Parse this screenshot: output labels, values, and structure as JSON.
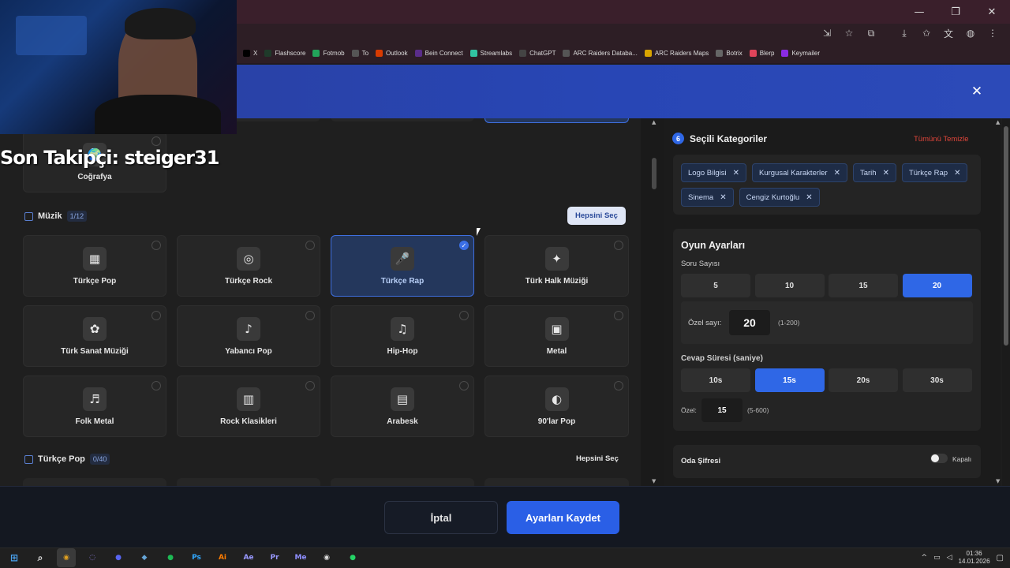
{
  "browser": {
    "bookmarks": [
      {
        "label": "X",
        "icon": "x-icon",
        "color": "#000000"
      },
      {
        "label": "Flashscore",
        "icon": "flashscore-icon",
        "color": "#1f3a2a"
      },
      {
        "label": "Fotmob",
        "icon": "fotmob-icon",
        "color": "#22a35a"
      },
      {
        "label": "To",
        "icon": "to-icon",
        "color": "#555555"
      },
      {
        "label": "Outlook",
        "icon": "outlook-icon",
        "color": "#d83b01"
      },
      {
        "label": "Bein Connect",
        "icon": "bein-icon",
        "color": "#5a2d8a"
      },
      {
        "label": "Streamlabs",
        "icon": "streamlabs-icon",
        "color": "#31c3a2"
      },
      {
        "label": "ChatGPT",
        "icon": "chatgpt-icon",
        "color": "#444444"
      },
      {
        "label": "ARC Raiders Databa...",
        "icon": "arc-database-icon",
        "color": "#555555"
      },
      {
        "label": "ARC Raiders Maps",
        "icon": "arc-maps-icon",
        "color": "#d9a400"
      },
      {
        "label": "Botrix",
        "icon": "botrix-icon",
        "color": "#666666"
      },
      {
        "label": "Blerp",
        "icon": "blerp-icon",
        "color": "#e0445a"
      },
      {
        "label": "Keymailer",
        "icon": "keymailer-icon",
        "color": "#8a2be2"
      }
    ]
  },
  "overlay": {
    "follower_text": "Son Takipçi: steiger31"
  },
  "left": {
    "top_card": {
      "label": "Coğrafya"
    },
    "music_section": {
      "title": "Müzik",
      "count": "1/12",
      "select_all": "Hepsini Seç"
    },
    "music_cards": [
      {
        "label": "Türkçe Pop",
        "selected": false,
        "icon": "tile-icon"
      },
      {
        "label": "Türkçe Rock",
        "selected": false,
        "icon": "record-icon"
      },
      {
        "label": "Türkçe Rap",
        "selected": true,
        "icon": "microphone-icon"
      },
      {
        "label": "Türk Halk Müziği",
        "selected": false,
        "icon": "ornament-icon"
      },
      {
        "label": "Türk Sanat Müziği",
        "selected": false,
        "icon": "flower-icon"
      },
      {
        "label": "Yabancı Pop",
        "selected": false,
        "icon": "guitar-icon"
      },
      {
        "label": "Hip-Hop",
        "selected": false,
        "icon": "hiphop-icon"
      },
      {
        "label": "Metal",
        "selected": false,
        "icon": "amp-icon"
      },
      {
        "label": "Folk Metal",
        "selected": false,
        "icon": "folk-guitar-icon"
      },
      {
        "label": "Rock Klasikleri",
        "selected": false,
        "icon": "speaker-icon"
      },
      {
        "label": "Arabesk",
        "selected": false,
        "icon": "building-icon"
      },
      {
        "label": "90'lar Pop",
        "selected": false,
        "icon": "palette-icon"
      }
    ],
    "pop_section": {
      "title": "Türkçe Pop",
      "count": "0/40",
      "select_all": "Hepsini Seç"
    }
  },
  "right": {
    "selected": {
      "count": "6",
      "title": "Seçili Kategoriler",
      "clear_all": "Tümünü Temizle",
      "chips": [
        "Logo Bilgisi",
        "Kurgusal Karakterler",
        "Tarih",
        "Türkçe Rap",
        "Sinema",
        "Cengiz Kurtoğlu"
      ]
    },
    "settings": {
      "title": "Oyun Ayarları",
      "question_count_label": "Soru Sayısı",
      "question_options": [
        "5",
        "10",
        "15",
        "20"
      ],
      "question_selected": "20",
      "custom_count_label": "Özel sayı:",
      "custom_count_value": "20",
      "custom_count_range": "(1-200)",
      "answer_time_label": "Cevap Süresi (saniye)",
      "time_options": [
        "10s",
        "15s",
        "20s",
        "30s"
      ],
      "time_selected": "15s",
      "custom_time_label": "Özel:",
      "custom_time_value": "15",
      "custom_time_range": "(5-600)"
    },
    "password": {
      "label": "Oda Şifresi",
      "toggle_state": "Kapalı"
    }
  },
  "footer": {
    "cancel": "İptal",
    "save": "Ayarları Kaydet"
  },
  "taskbar": {
    "time": "01:36",
    "date": "14.01.2026",
    "apps": [
      {
        "name": "chrome-icon",
        "glyph": "◉",
        "color": "#e0a020"
      },
      {
        "name": "app-icon",
        "glyph": "◌",
        "color": "#8a7ad8"
      },
      {
        "name": "discord-icon",
        "glyph": "●",
        "color": "#5865f2"
      },
      {
        "name": "steam-icon",
        "glyph": "◆",
        "color": "#66a6d8"
      },
      {
        "name": "spotify-icon",
        "glyph": "●",
        "color": "#1db954"
      },
      {
        "name": "photoshop-icon",
        "glyph": "Ps",
        "color": "#31a8ff"
      },
      {
        "name": "illustrator-icon",
        "glyph": "Ai",
        "color": "#ff7c00"
      },
      {
        "name": "after-effects-icon",
        "glyph": "Ae",
        "color": "#9999ff"
      },
      {
        "name": "premiere-icon",
        "glyph": "Pr",
        "color": "#9999ff"
      },
      {
        "name": "media-encoder-icon",
        "glyph": "Me",
        "color": "#8f8fff"
      },
      {
        "name": "obs-icon",
        "glyph": "◉",
        "color": "#dddddd"
      },
      {
        "name": "whatsapp-icon",
        "glyph": "●",
        "color": "#25d366"
      }
    ]
  },
  "colors": {
    "accent": "#2f67e6",
    "clear_all": "#e0453a"
  }
}
